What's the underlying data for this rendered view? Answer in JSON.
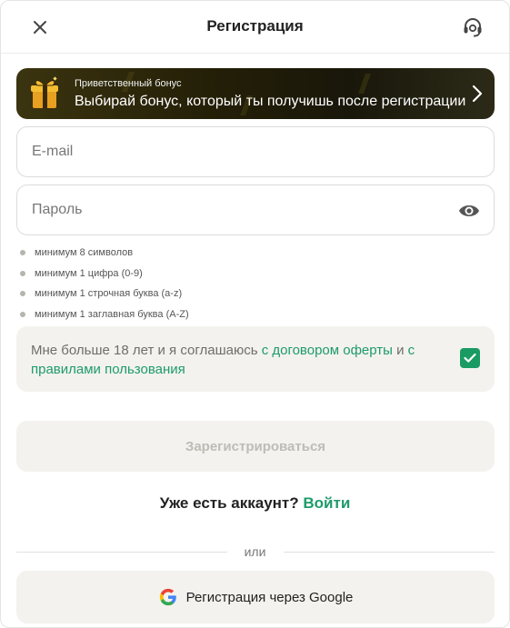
{
  "header": {
    "title": "Регистрация",
    "close_icon": "close-icon",
    "support_icon": "support-headset-icon"
  },
  "bonus": {
    "kicker": "Приветственный бонус",
    "text": "Выбирай бонус, который ты получишь после регистрации",
    "icon": "gift-icon",
    "chevron": "chevron-right-icon"
  },
  "form": {
    "email_placeholder": "E-mail",
    "email_value": "",
    "password_placeholder": "Пароль",
    "password_value": "",
    "eye_icon": "eye-icon"
  },
  "password_rules": [
    "минимум 8 символов",
    "минимум 1 цифра (0-9)",
    "минимум 1 строчная буква (a-z)",
    "минимум 1 заглавная буква (A-Z)"
  ],
  "agreement": {
    "prefix": "Мне больше 18 лет и я соглашаюсь ",
    "link_offer": "с договором оферты",
    "middle": " и ",
    "link_rules": "с правилами пользования",
    "checked": true
  },
  "register_button": "Зарегистрироваться",
  "login": {
    "question": "Уже есть аккаунт?",
    "link": "Войти"
  },
  "divider_label": "или",
  "google_button": "Регистрация через Google",
  "colors": {
    "accent_green": "#1e9b6a",
    "checkbox_green": "#199b63",
    "panel_bg": "#f3f2ee",
    "bonus_bg_dark": "#19170a"
  }
}
